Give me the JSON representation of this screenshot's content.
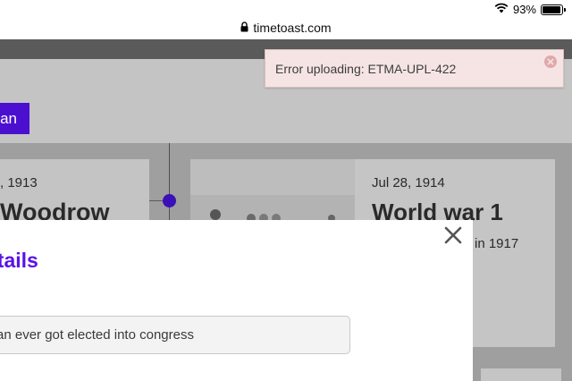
{
  "status_bar": {
    "battery_percent": "93%",
    "battery_level": 0.93
  },
  "browser": {
    "url": "timetoast.com"
  },
  "header": {
    "button_label": "an"
  },
  "timeline": {
    "events": [
      {
        "date": ", 1913",
        "title": "Woodrow"
      },
      {
        "date": "Jul 28, 1914",
        "title": "World war 1",
        "snippet": "in 1917"
      }
    ]
  },
  "modal": {
    "title": "etails",
    "input_value": "an ever got elected into congress"
  },
  "toast": {
    "message": "Error uploading: ETMA-UPL-422"
  },
  "colors": {
    "accent": "#5a12e8",
    "button_purple": "#4b0fd0",
    "toast_background": "#f6e4e4",
    "overlay": "#9f9f9f"
  },
  "icons": {
    "wifi": "wifi-icon",
    "battery": "battery-icon",
    "lock": "lock-icon",
    "modal_close": "close-icon",
    "toast_close": "close-circle-icon"
  }
}
